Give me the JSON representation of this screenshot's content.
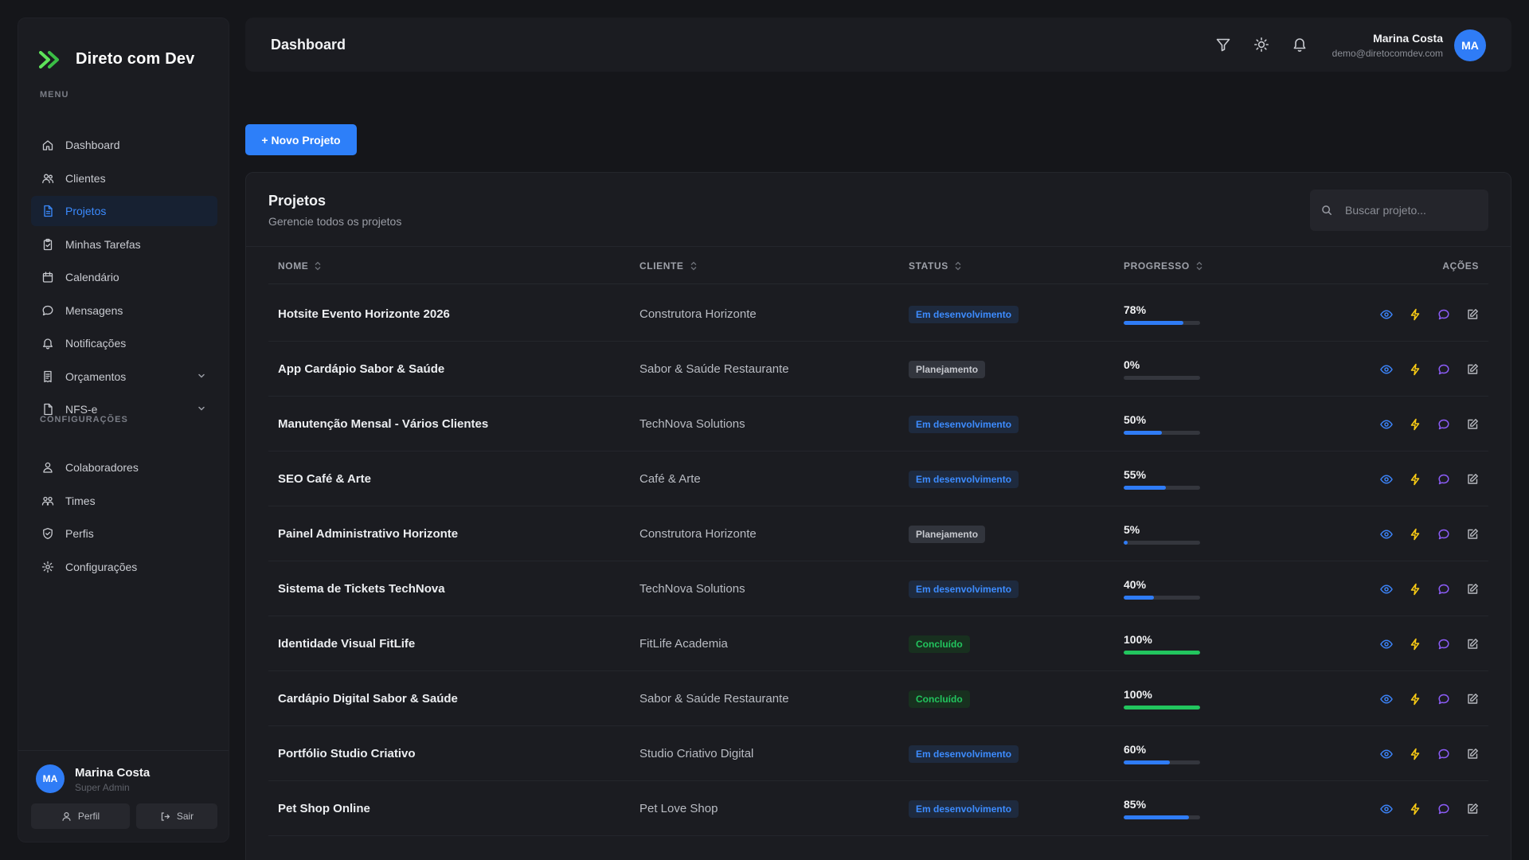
{
  "brand": {
    "name": "Direto com Dev",
    "accent": "#5ee35a"
  },
  "sidebar": {
    "menu_label": "MENU",
    "config_label": "CONFIGURAÇÕES",
    "items": [
      {
        "label": "Dashboard",
        "icon": "home-icon"
      },
      {
        "label": "Clientes",
        "icon": "users-icon"
      },
      {
        "label": "Projetos",
        "icon": "file-icon",
        "active": true
      },
      {
        "label": "Minhas Tarefas",
        "icon": "clipboard-icon"
      },
      {
        "label": "Calendário",
        "icon": "calendar-icon"
      },
      {
        "label": "Mensagens",
        "icon": "message-icon"
      },
      {
        "label": "Notificações",
        "icon": "bell-icon"
      },
      {
        "label": "Orçamentos",
        "icon": "receipt-icon",
        "expandable": true
      },
      {
        "label": "NFS-e",
        "icon": "document-icon",
        "expandable": true
      }
    ],
    "config_items": [
      {
        "label": "Colaboradores",
        "icon": "user-group-icon"
      },
      {
        "label": "Times",
        "icon": "team-icon"
      },
      {
        "label": "Perfis",
        "icon": "shield-icon"
      },
      {
        "label": "Configurações",
        "icon": "gear-icon"
      }
    ],
    "footer": {
      "initials": "MA",
      "name": "Marina Costa",
      "role": "Super Admin",
      "profile_label": "Perfil",
      "logout_label": "Sair"
    }
  },
  "header": {
    "title": "Dashboard",
    "user": {
      "name": "Marina Costa",
      "email": "demo@diretocomdev.com",
      "initials": "MA"
    }
  },
  "toolbar": {
    "new_project_label": "+ Novo Projeto"
  },
  "projects": {
    "title": "Projetos",
    "subtitle": "Gerencie todos os projetos",
    "search_placeholder": "Buscar projeto...",
    "columns": {
      "name": "NOME",
      "client": "CLIENTE",
      "status": "STATUS",
      "progress": "PROGRESSO",
      "actions": "AÇÕES"
    },
    "rows": [
      {
        "name": "Hotsite Evento Horizonte 2026",
        "client": "Construtora Horizonte",
        "status": "Em desenvolvimento",
        "status_kind": "dev",
        "progress": 78,
        "progress_label": "78%"
      },
      {
        "name": "App Cardápio Sabor & Saúde",
        "client": "Sabor & Saúde Restaurante",
        "status": "Planejamento",
        "status_kind": "plan",
        "progress": 0,
        "progress_label": "0%"
      },
      {
        "name": "Manutenção Mensal - Vários Clientes",
        "client": "TechNova Solutions",
        "status": "Em desenvolvimento",
        "status_kind": "dev",
        "progress": 50,
        "progress_label": "50%"
      },
      {
        "name": "SEO Café & Arte",
        "client": "Café & Arte",
        "status": "Em desenvolvimento",
        "status_kind": "dev",
        "progress": 55,
        "progress_label": "55%"
      },
      {
        "name": "Painel Administrativo Horizonte",
        "client": "Construtora Horizonte",
        "status": "Planejamento",
        "status_kind": "plan",
        "progress": 5,
        "progress_label": "5%"
      },
      {
        "name": "Sistema de Tickets TechNova",
        "client": "TechNova Solutions",
        "status": "Em desenvolvimento",
        "status_kind": "dev",
        "progress": 40,
        "progress_label": "40%"
      },
      {
        "name": "Identidade Visual FitLife",
        "client": "FitLife Academia",
        "status": "Concluído",
        "status_kind": "done",
        "progress": 100,
        "progress_label": "100%"
      },
      {
        "name": "Cardápio Digital Sabor & Saúde",
        "client": "Sabor & Saúde Restaurante",
        "status": "Concluído",
        "status_kind": "done",
        "progress": 100,
        "progress_label": "100%"
      },
      {
        "name": "Portfólio Studio Criativo",
        "client": "Studio Criativo Digital",
        "status": "Em desenvolvimento",
        "status_kind": "dev",
        "progress": 60,
        "progress_label": "60%"
      },
      {
        "name": "Pet Shop Online",
        "client": "Pet Love Shop",
        "status": "Em desenvolvimento",
        "status_kind": "dev",
        "progress": 85,
        "progress_label": "85%"
      }
    ]
  },
  "colors": {
    "primary": "#2d7ff9",
    "success": "#22c55e",
    "view_icon": "#3b82f6",
    "bolt_icon": "#facc15",
    "chat_icon": "#8b5cf6",
    "edit_icon": "#b8bac0"
  }
}
